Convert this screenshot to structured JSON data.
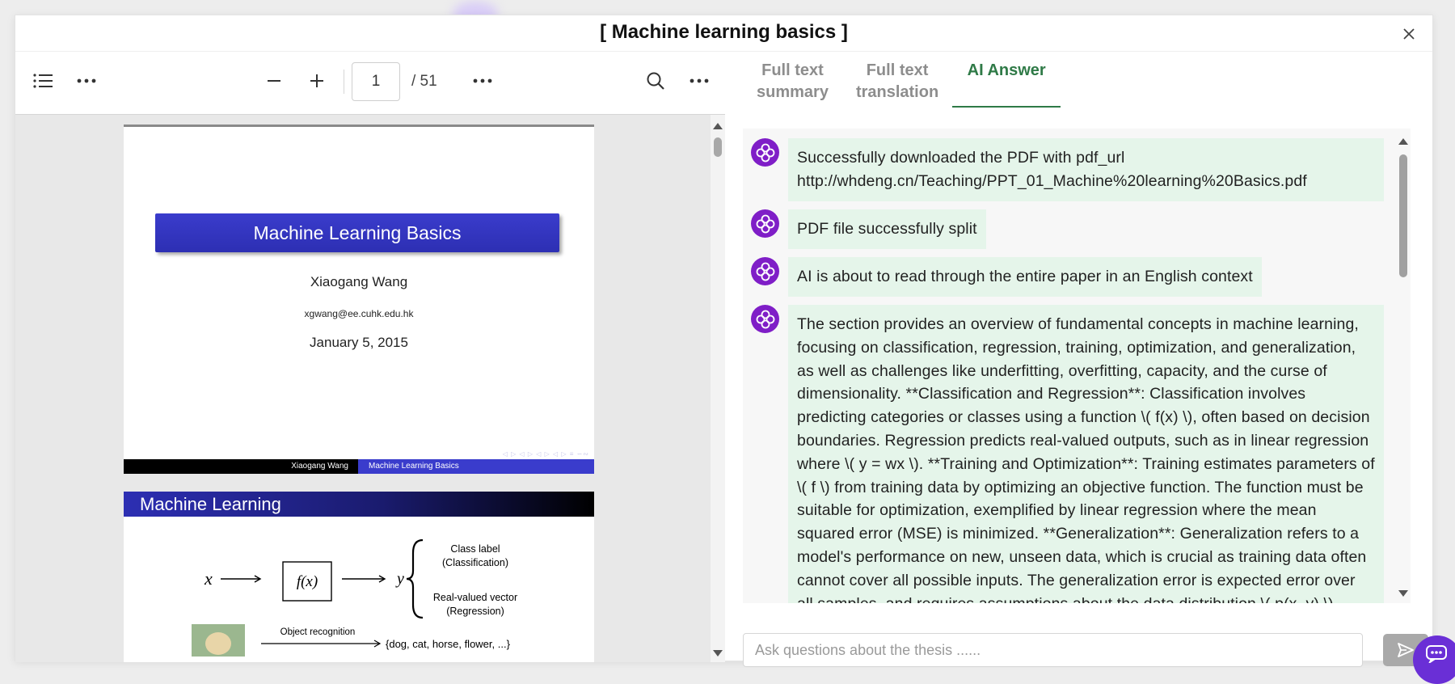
{
  "dialog": {
    "title": "[ Machine learning basics ]"
  },
  "pdf_toolbar": {
    "page_current": "1",
    "page_total": "/ 51"
  },
  "slide1": {
    "title": "Machine Learning Basics",
    "author": "Xiaogang Wang",
    "email": "xgwang@ee.cuhk.edu.hk",
    "date": "January 5, 2015",
    "footer_left": "Xiaogang Wang",
    "footer_right": "Machine Learning Basics"
  },
  "slide2": {
    "title": "Machine Learning",
    "diagram": {
      "input": "x",
      "function": "f(x)",
      "output": "y",
      "outcome_top_line1": "Class label",
      "outcome_top_line2": "(Classification)",
      "outcome_bottom_line1": "Real-valued vector",
      "outcome_bottom_line2": "(Regression)",
      "example_label": "Object recognition",
      "example_set": "{dog, cat, horse, flower, ...}"
    }
  },
  "tabs": [
    {
      "line1": "Full text",
      "line2": "summary",
      "active": false
    },
    {
      "line1": "Full text",
      "line2": "translation",
      "active": false
    },
    {
      "line1": "AI Answer",
      "line2": "",
      "active": true
    }
  ],
  "messages": [
    {
      "text": "Successfully downloaded the PDF with pdf_url http://whdeng.cn/Teaching/PPT_01_Machine%20learning%20Basics.pdf"
    },
    {
      "text": "PDF file successfully split"
    },
    {
      "text": "AI is about to read through the entire paper in an English context"
    },
    {
      "text": "The section provides an overview of fundamental concepts in machine learning, focusing on classification, regression, training, optimization, and generalization, as well as challenges like underfitting, overfitting, capacity, and the curse of dimensionality. **Classification and Regression**: Classification involves predicting categories or classes using a function \\( f(x) \\), often based on decision boundaries. Regression predicts real-valued outputs, such as in linear regression where \\( y = wx \\). **Training and Optimization**: Training estimates parameters of \\( f \\) from training data by optimizing an objective function. The function must be suitable for optimization, exemplified by linear regression where the mean squared error (MSE) is minimized. **Generalization**: Generalization refers to a model's performance on new, unseen data, which is crucial as training data often cannot cover all possible inputs. The generalization error is expected error over all samples, and requires assumptions about the data distribution \\( p(x, y) \\)."
    }
  ],
  "chat_input": {
    "placeholder": "Ask questions about the thesis ......"
  },
  "colors": {
    "accent": "#2f7a47",
    "avatar": "#7f1ec7",
    "bubble": "#e5f5ea",
    "slide_blue": "#3a3ccc"
  }
}
